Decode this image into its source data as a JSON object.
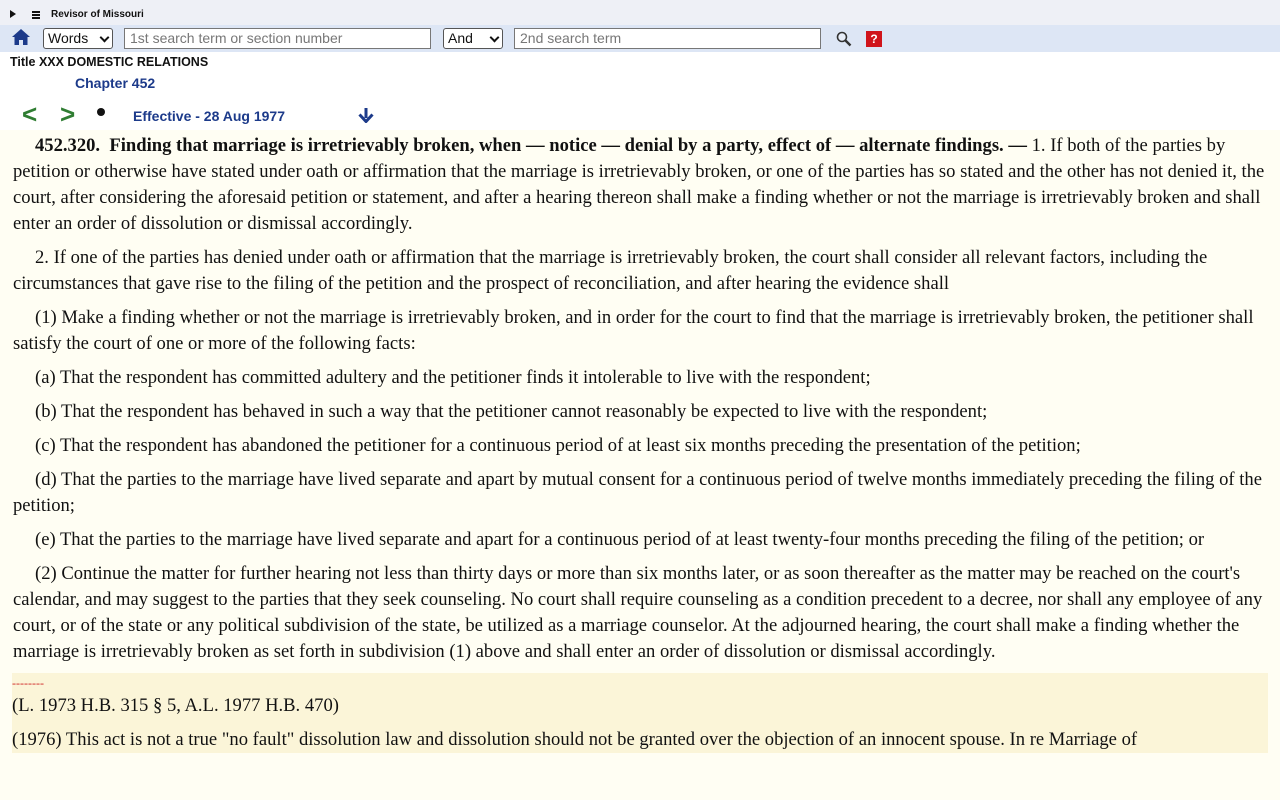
{
  "site_name": "Revisor of Missouri",
  "search": {
    "mode_selected": "Words",
    "term1_placeholder": "1st search term or section number",
    "connector_selected": "And",
    "term2_placeholder": "2nd search term",
    "help_label": "?"
  },
  "breadcrumb": {
    "title": "Title XXX DOMESTIC RELATIONS",
    "chapter": "Chapter 452"
  },
  "nav": {
    "prev_label": "<",
    "next_label": ">",
    "effective": "Effective - 28 Aug 1977"
  },
  "section": {
    "number": "452.320.",
    "heading": "Finding that marriage is irretrievably broken, when — notice — denial by a party, effect of — alternate findings. —",
    "para1": "1.  If both of the parties by petition or otherwise have stated under oath or affirmation that the marriage is irretrievably broken, or one of the parties has so stated and the other has not denied it, the court, after considering the aforesaid petition or statement, and after a hearing thereon shall make a finding whether or not the marriage is irretrievably broken and shall enter an order of dissolution or dismissal accordingly.",
    "para2": "2.  If one of the parties has denied under oath or affirmation that the marriage is irretrievably broken, the court shall consider all relevant factors, including the circumstances that gave rise to the filing of the petition and the prospect of reconciliation, and after hearing the evidence shall",
    "item1": "(1)  Make a finding whether or not the marriage is irretrievably broken, and in order for the court to find that the marriage is irretrievably broken, the petitioner shall satisfy the court of one or more of the following facts:",
    "item_a": "(a)  That the respondent has committed adultery and the petitioner finds it intolerable to live with the respondent;",
    "item_b": "(b)  That the respondent has behaved in such a way that the petitioner cannot reasonably be expected to live with the respondent;",
    "item_c": "(c)  That the respondent has abandoned the petitioner for a continuous period of at least six months preceding the presentation of the petition;",
    "item_d": "(d)  That the parties to the marriage have lived separate and apart by mutual consent for a continuous period of twelve months immediately preceding the filing of the petition;",
    "item_e": "(e)  That the parties to the marriage have lived separate and apart for a continuous period of at least twenty-four months preceding the filing of the petition; or",
    "item2": "(2)  Continue the matter for further hearing not less than thirty days or more than six months later, or as soon thereafter as the matter may be reached on the court's calendar, and may suggest to the parties that they seek counseling.  No court shall require counseling as a condition precedent to a decree, nor shall any employee of any court, or of the state or any political subdivision of the state, be utilized as a marriage counselor.  At the adjourned hearing, the court shall make a finding whether the marriage is irretrievably broken as set forth in subdivision (1) above and shall enter an order of dissolution or dismissal accordingly."
  },
  "footnote": {
    "divider": "--------",
    "history": "(L. 1973 H.B. 315 § 5, A.L. 1977 H.B. 470)",
    "annotation": "(1976) This act is not a true \"no fault\" dissolution law and dissolution should not be granted over the objection of an innocent spouse. In re Marriage of"
  },
  "colors": {
    "search_bar_bg": "#dde6f5",
    "link_blue": "#1c3a8a",
    "nav_green": "#2f7d32",
    "content_bg": "#fffef3",
    "footnote_bg": "#fbf5d8",
    "help_red": "#d0141b"
  },
  "icons": [
    "expand-triangle-icon",
    "menu-icon",
    "home-icon",
    "dropdown-chevron-icon",
    "magnifier-icon",
    "help-icon",
    "scroll-down-arrow-icon"
  ]
}
